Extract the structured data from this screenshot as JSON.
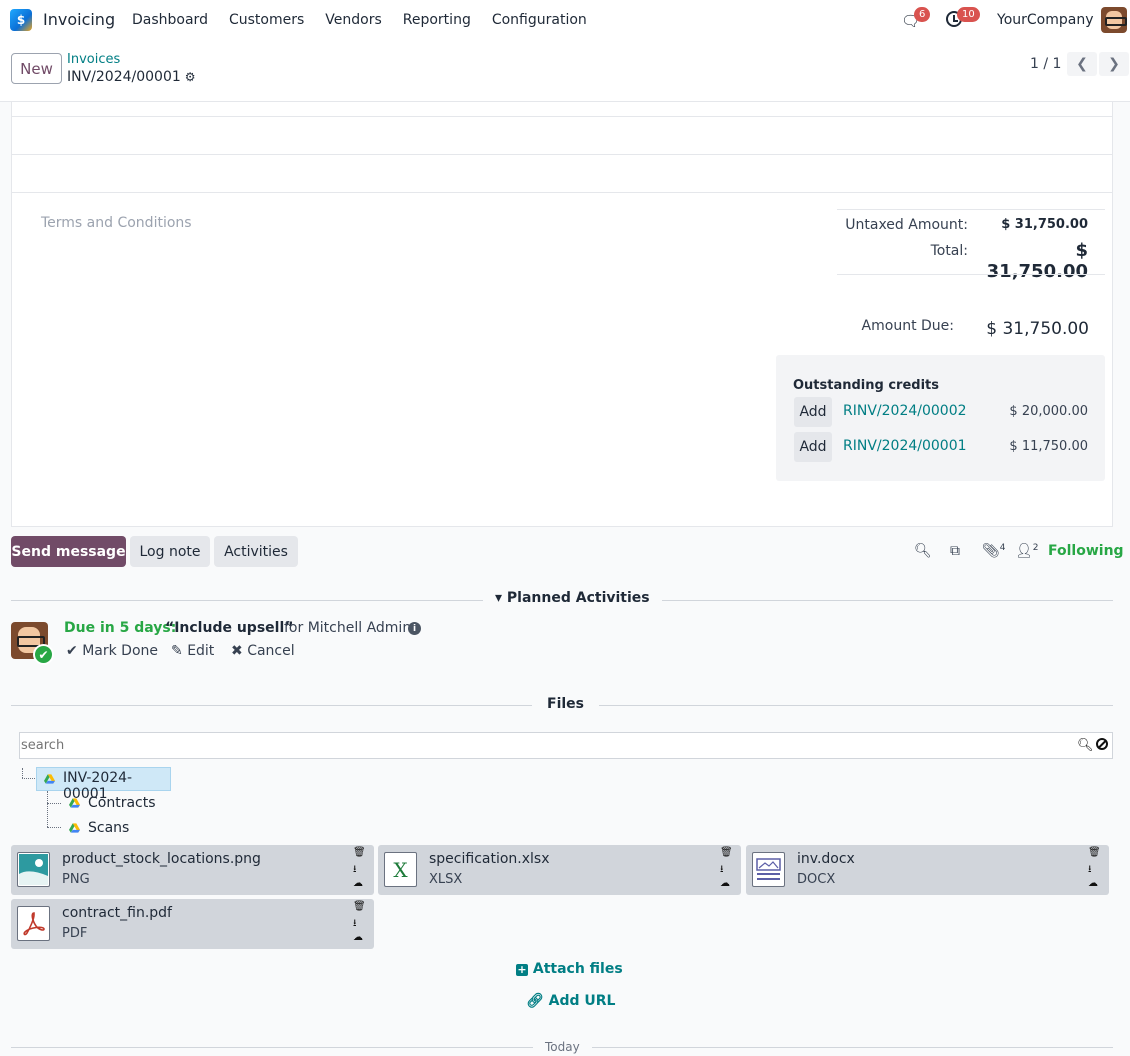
{
  "navbar": {
    "app_name": "Invoicing",
    "menu": [
      "Dashboard",
      "Customers",
      "Vendors",
      "Reporting",
      "Configuration"
    ],
    "messages_count": "6",
    "activities_count": "10",
    "company": "YourCompany"
  },
  "control": {
    "new_label": "New",
    "breadcrumb_parent": "Invoices",
    "breadcrumb_current": "INV/2024/00001",
    "pager": "1 / 1"
  },
  "form": {
    "terms_placeholder": "Terms and Conditions",
    "untaxed_label": "Untaxed Amount:",
    "untaxed_value": "$ 31,750.00",
    "total_label": "Total:",
    "total_value": "$ 31,750.00",
    "amount_due_label": "Amount Due:",
    "amount_due_value": "$ 31,750.00",
    "outstanding": {
      "title": "Outstanding credits",
      "items": [
        {
          "add": "Add",
          "ref": "RINV/2024/00002",
          "amount": "$ 20,000.00"
        },
        {
          "add": "Add",
          "ref": "RINV/2024/00001",
          "amount": "$ 11,750.00"
        }
      ]
    }
  },
  "chatter": {
    "send_message": "Send message",
    "log_note": "Log note",
    "activities": "Activities",
    "attachments_count": "4",
    "followers_count": "2",
    "following": "Following",
    "planned_title": "Planned Activities",
    "activity": {
      "due": "Due in 5 days:",
      "summary": "“Include upsell”",
      "for_user": "for Mitchell Admin",
      "mark_done": "Mark Done",
      "edit": "Edit",
      "cancel": "Cancel"
    },
    "files_title": "Files",
    "search_placeholder": "search",
    "tree": {
      "root": "INV-2024-00001",
      "children": [
        "Contracts",
        "Scans"
      ]
    },
    "files": [
      {
        "name": "product_stock_locations.png",
        "type": "PNG",
        "icon": "image-file-icon"
      },
      {
        "name": "specification.xlsx",
        "type": "XLSX",
        "icon": "spreadsheet-file-icon"
      },
      {
        "name": "inv.docx",
        "type": "DOCX",
        "icon": "document-file-icon"
      },
      {
        "name": "contract_fin.pdf",
        "type": "PDF",
        "icon": "pdf-file-icon"
      }
    ],
    "attach_files": "Attach files",
    "add_url": "Add URL",
    "today": "Today"
  }
}
